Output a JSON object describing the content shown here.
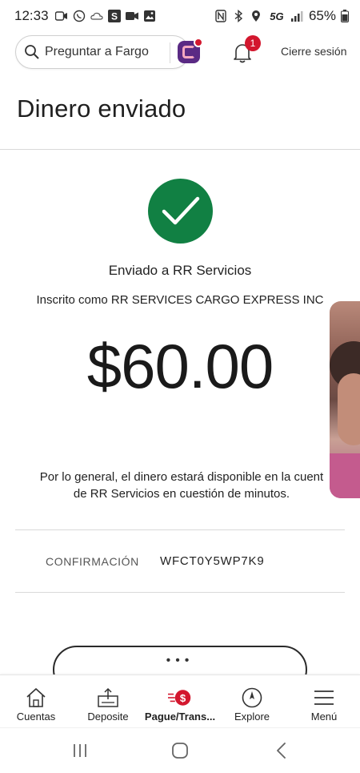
{
  "status_bar": {
    "time": "12:33",
    "battery_percent": "65%",
    "network": "5G",
    "icons_left": [
      "video-call-icon",
      "whatsapp-icon",
      "cloud-icon",
      "s-app-icon",
      "camera-icon",
      "image-icon"
    ],
    "icons_right": [
      "nfc-icon",
      "bluetooth-icon",
      "location-icon",
      "5g-icon",
      "signal-icon",
      "battery-icon"
    ]
  },
  "header": {
    "search_label": "Preguntar a Fargo",
    "notification_count": "1",
    "signout_label": "Cierre sesión"
  },
  "page": {
    "title": "Dinero enviado"
  },
  "confirmation": {
    "sent_to": "Enviado a RR Servicios",
    "registered_as": "Inscrito como RR SERVICES CARGO EXPRESS INC",
    "amount": "$60.00",
    "availability_line1": "Por lo general, el dinero estará disponible en la cuent",
    "availability_line2": "de RR Servicios en cuestión de minutos.",
    "label": "CONFIRMACIÓN",
    "number": "WFCT0Y5WP7K9"
  },
  "bottom_nav": {
    "items": [
      {
        "label": "Cuentas",
        "icon": "home-icon"
      },
      {
        "label": "Deposite",
        "icon": "deposit-icon"
      },
      {
        "label": "Pague/Trans...",
        "icon": "pay-transfer-icon",
        "active": true
      },
      {
        "label": "Explore",
        "icon": "compass-icon"
      },
      {
        "label": "Menú",
        "icon": "menu-icon"
      }
    ]
  },
  "colors": {
    "success_green": "#118043",
    "alert_red": "#d3172e",
    "fargo_purple": "#5a2a84"
  }
}
